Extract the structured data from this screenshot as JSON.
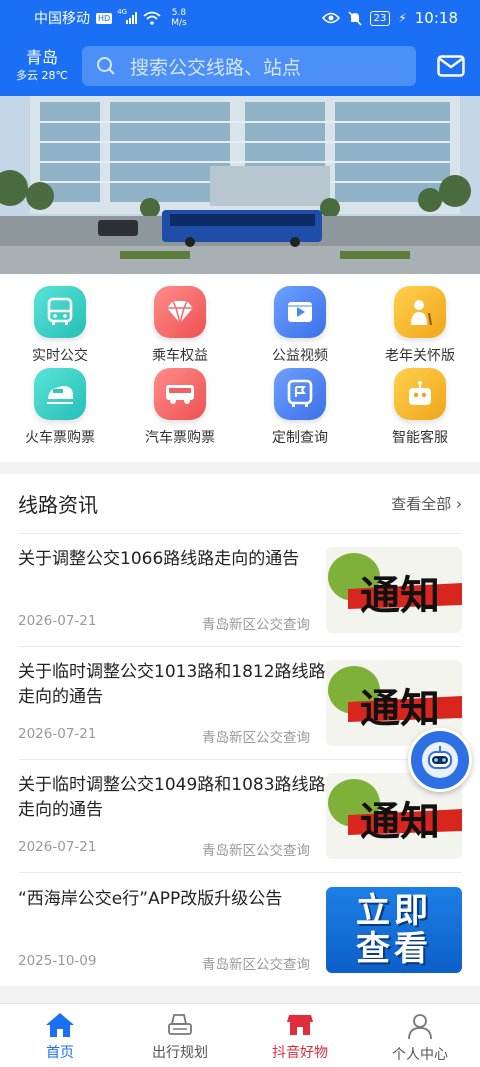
{
  "status_bar": {
    "carrier": "中国移动",
    "network_badge": "HD",
    "signal_type": "4G",
    "speed_value": "5.8",
    "speed_unit": "M/s",
    "battery": "23",
    "time": "10:18"
  },
  "header": {
    "city": "青岛",
    "weather": "多云 28℃",
    "search_placeholder": "搜索公交线路、站点"
  },
  "services": [
    {
      "label": "实时公交",
      "icon": "bus-icon",
      "color": "#3fd1c6"
    },
    {
      "label": "乘车权益",
      "icon": "diamond-icon",
      "color": "#f76c6c"
    },
    {
      "label": "公益视频",
      "icon": "video-icon",
      "color": "#4b86f5"
    },
    {
      "label": "老年关怀版",
      "icon": "elder-icon",
      "color": "#f7b92b"
    },
    {
      "label": "火车票购票",
      "icon": "train-icon",
      "color": "#3fd1c6"
    },
    {
      "label": "汽车票购票",
      "icon": "coach-icon",
      "color": "#f76c6c"
    },
    {
      "label": "定制查询",
      "icon": "custom-bus-icon",
      "color": "#4b86f5"
    },
    {
      "label": "智能客服",
      "icon": "robot-icon",
      "color": "#f7b92b"
    }
  ],
  "news": {
    "title": "线路资讯",
    "more": "查看全部",
    "more_chevron": "›",
    "items": [
      {
        "headline": "关于调整公交1066路线路走向的通告",
        "date": "2026-07-21",
        "source": "青岛新区公交查询",
        "thumb": "notice",
        "thumb_text": "通知"
      },
      {
        "headline": "关于临时调整公交1013路和1812路线路走向的通告",
        "date": "2026-07-21",
        "source": "青岛新区公交查询",
        "thumb": "notice",
        "thumb_text": "通知"
      },
      {
        "headline": "关于临时调整公交1049路和1083路线路走向的通告",
        "date": "2026-07-21",
        "source": "青岛新区公交查询",
        "thumb": "notice",
        "thumb_text": "通知"
      },
      {
        "headline": "“西海岸公交e行”APP改版升级公告",
        "date": "2025-10-09",
        "source": "青岛新区公交查询",
        "thumb": "view",
        "thumb_text": "立即查看"
      }
    ]
  },
  "bottom_nav": [
    {
      "label": "首页",
      "icon": "home-icon",
      "state": "active"
    },
    {
      "label": "出行规划",
      "icon": "route-plan-icon",
      "state": ""
    },
    {
      "label": "抖音好物",
      "icon": "shop-icon",
      "state": "hot"
    },
    {
      "label": "个人中心",
      "icon": "person-icon",
      "state": ""
    }
  ],
  "colors": {
    "brand": "#1b6ff5",
    "hot": "#e02e3c"
  }
}
